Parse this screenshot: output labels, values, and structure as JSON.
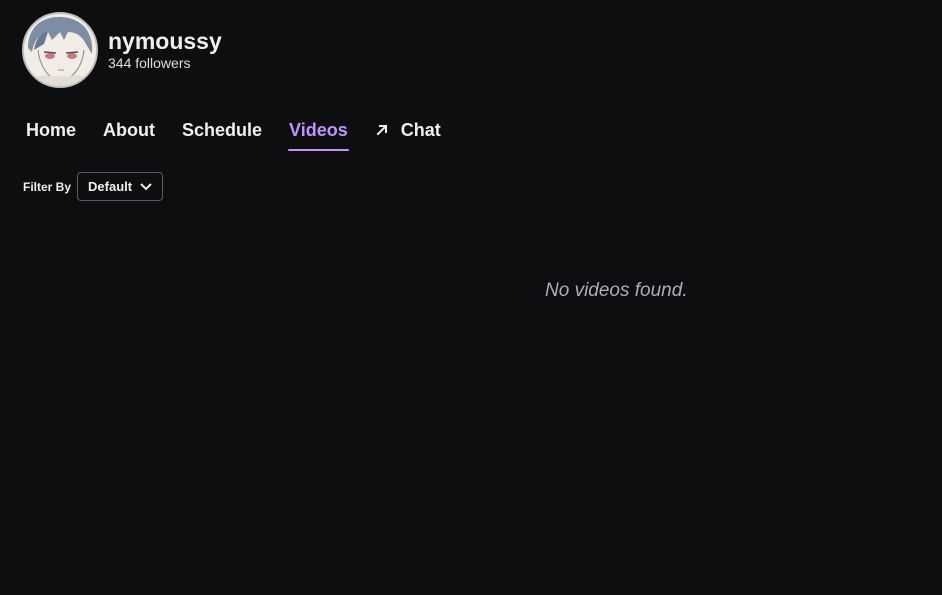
{
  "channel": {
    "name": "nymoussy",
    "followers": "344 followers"
  },
  "tabs": [
    {
      "label": "Home"
    },
    {
      "label": "About"
    },
    {
      "label": "Schedule"
    },
    {
      "label": "Videos",
      "active": true
    },
    {
      "label": "Chat",
      "icon": "external-arrow-icon"
    }
  ],
  "filter": {
    "label": "Filter By",
    "selected": "Default",
    "icon": "chevron-down-icon"
  },
  "empty_state": {
    "message": "No videos found."
  },
  "colors": {
    "background": "#0e0e10",
    "accent": "#bf94ff",
    "text": "#efeff1",
    "muted": "#adadb8"
  }
}
